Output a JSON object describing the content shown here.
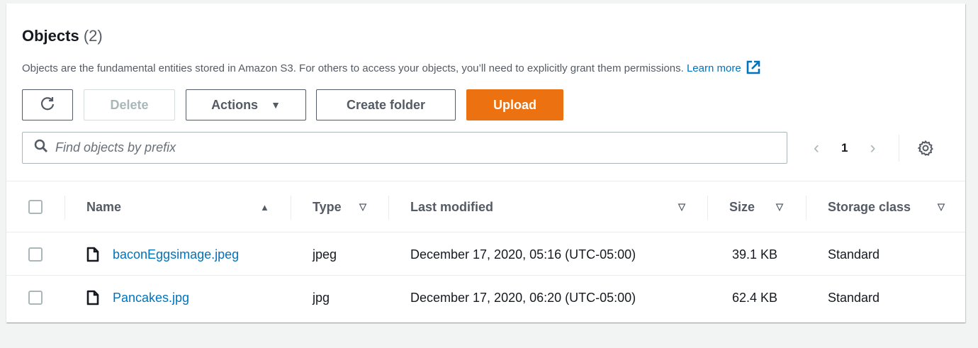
{
  "header": {
    "title": "Objects",
    "count": "(2)",
    "description": "Objects are the fundamental entities stored in Amazon S3. For others to access your objects, you’ll need to explicitly grant them permissions.",
    "learn_more": "Learn more"
  },
  "toolbar": {
    "delete_label": "Delete",
    "actions_label": "Actions",
    "create_folder_label": "Create folder",
    "upload_label": "Upload"
  },
  "search": {
    "placeholder": "Find objects by prefix",
    "value": ""
  },
  "pagination": {
    "current_page": "1"
  },
  "table": {
    "columns": [
      "Name",
      "Type",
      "Last modified",
      "Size",
      "Storage class"
    ],
    "rows": [
      {
        "name": "baconEggsimage.jpeg",
        "type": "jpeg",
        "last_modified": "December 17, 2020, 05:16 (UTC-05:00)",
        "size": "39.1 KB",
        "storage_class": "Standard"
      },
      {
        "name": "Pancakes.jpg",
        "type": "jpg",
        "last_modified": "December 17, 2020, 06:20 (UTC-05:00)",
        "size": "62.4 KB",
        "storage_class": "Standard"
      }
    ]
  },
  "icons": {
    "refresh": "refresh-icon",
    "search": "search-icon",
    "settings": "gear-icon",
    "external_link": "external-link-icon",
    "file": "file-icon"
  },
  "colors": {
    "accent": "#ec7211",
    "link": "#0073bb"
  }
}
